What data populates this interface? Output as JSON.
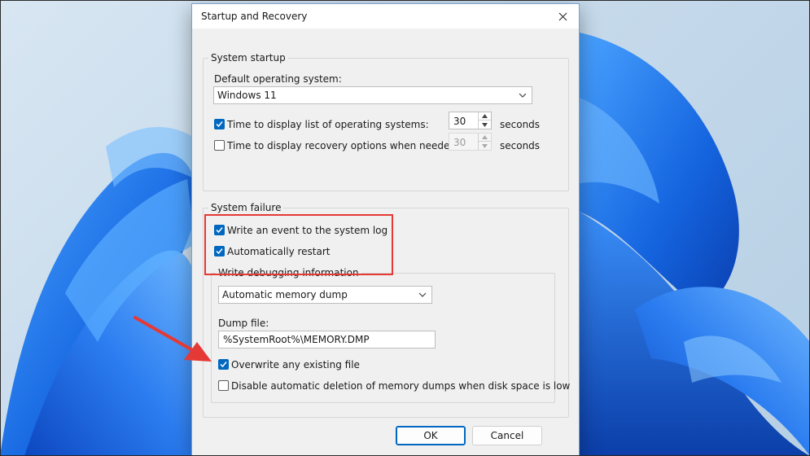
{
  "dialog": {
    "title": "Startup and Recovery",
    "system_startup": {
      "legend": "System startup",
      "default_os_label": "Default operating system:",
      "default_os_value": "Windows 11",
      "display_list": {
        "label": "Time to display list of operating systems:",
        "checked": true,
        "value": "30",
        "unit": "seconds"
      },
      "display_recovery": {
        "label": "Time to display recovery options when needed:",
        "checked": false,
        "value": "30",
        "unit": "seconds"
      }
    },
    "system_failure": {
      "legend": "System failure",
      "write_event": {
        "label": "Write an event to the system log",
        "checked": true
      },
      "auto_restart": {
        "label": "Automatically restart",
        "checked": true
      },
      "debug_info": {
        "legend": "Write debugging information",
        "dump_type": "Automatic memory dump",
        "dump_file_label": "Dump file:",
        "dump_file_value": "%SystemRoot%\\MEMORY.DMP",
        "overwrite": {
          "label": "Overwrite any existing file",
          "checked": true
        },
        "disable_auto_delete": {
          "label": "Disable automatic deletion of memory dumps when disk space is low",
          "checked": false
        }
      }
    },
    "buttons": {
      "ok": "OK",
      "cancel": "Cancel"
    }
  },
  "colors": {
    "accent": "#0067c0",
    "annotation": "#e53935"
  }
}
